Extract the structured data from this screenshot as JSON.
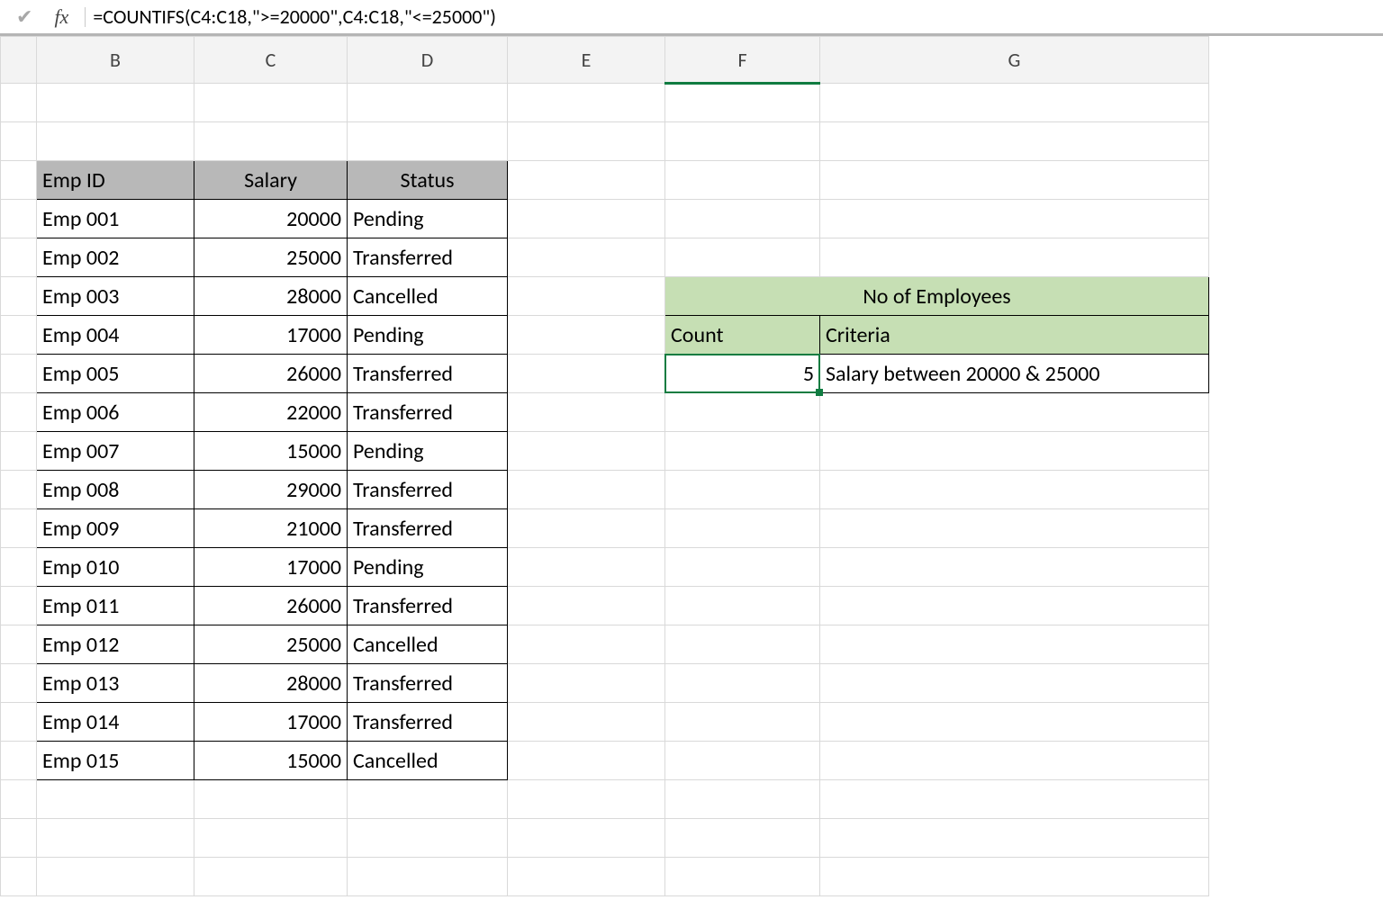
{
  "formula_bar": {
    "fx": "fx",
    "formula": "=COUNTIFS(C4:C18,\">=20000\",C4:C18,\"<=25000\")"
  },
  "columns": [
    "B",
    "C",
    "D",
    "E",
    "F",
    "G"
  ],
  "selected_column": "F",
  "selected_cell": "F8",
  "dataTable": {
    "headers": [
      "Emp ID",
      "Salary",
      "Status"
    ],
    "rows": [
      {
        "id": "Emp 001",
        "salary": "20000",
        "status": "Pending"
      },
      {
        "id": "Emp 002",
        "salary": "25000",
        "status": "Transferred"
      },
      {
        "id": "Emp 003",
        "salary": "28000",
        "status": "Cancelled"
      },
      {
        "id": "Emp 004",
        "salary": "17000",
        "status": "Pending"
      },
      {
        "id": "Emp 005",
        "salary": "26000",
        "status": "Transferred"
      },
      {
        "id": "Emp 006",
        "salary": "22000",
        "status": "Transferred"
      },
      {
        "id": "Emp 007",
        "salary": "15000",
        "status": "Pending"
      },
      {
        "id": "Emp 008",
        "salary": "29000",
        "status": "Transferred"
      },
      {
        "id": "Emp 009",
        "salary": "21000",
        "status": "Transferred"
      },
      {
        "id": "Emp 010",
        "salary": "17000",
        "status": "Pending"
      },
      {
        "id": "Emp 011",
        "salary": "26000",
        "status": "Transferred"
      },
      {
        "id": "Emp 012",
        "salary": "25000",
        "status": "Cancelled"
      },
      {
        "id": "Emp 013",
        "salary": "28000",
        "status": "Transferred"
      },
      {
        "id": "Emp 014",
        "salary": "17000",
        "status": "Transferred"
      },
      {
        "id": "Emp 015",
        "salary": "15000",
        "status": "Cancelled"
      }
    ]
  },
  "summary": {
    "title": "No of Employees",
    "countLabel": "Count",
    "criteriaLabel": "Criteria",
    "countValue": "5",
    "criteriaValue": "Salary between 20000 & 25000"
  }
}
